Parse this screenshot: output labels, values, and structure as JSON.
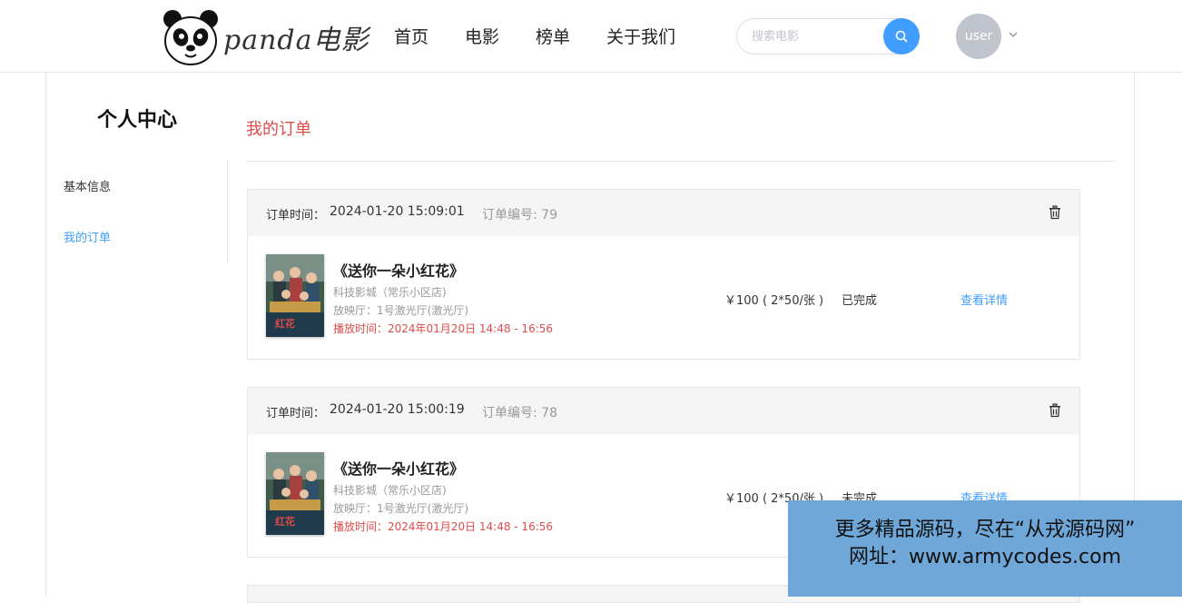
{
  "header": {
    "logo_text": "panda电影",
    "nav": [
      "首页",
      "电影",
      "榜单",
      "关于我们"
    ],
    "search_placeholder": "搜索电影",
    "user_label": "user"
  },
  "sidebar": {
    "title": "个人中心",
    "items": [
      {
        "label": "基本信息",
        "active": false
      },
      {
        "label": "我的订单",
        "active": true
      }
    ]
  },
  "main": {
    "section_title": "我的订单",
    "orders": [
      {
        "time_label": "订单时间：",
        "time": "2024-01-20 15:09:01",
        "order_no": "订单编号: 79",
        "movie_title": "《送你一朵小红花》",
        "cinema": "科技影城（常乐小区店)",
        "hall": "放映厅：1号激光厅(激光厅)",
        "showtime": "播放时间：2024年01月20日 14:48 - 16:56",
        "price": "￥100 ( 2*50/张 )",
        "status": "已完成",
        "detail_label": "查看详情"
      },
      {
        "time_label": "订单时间：",
        "time": "2024-01-20 15:00:19",
        "order_no": "订单编号: 78",
        "movie_title": "《送你一朵小红花》",
        "cinema": "科技影城（常乐小区店)",
        "hall": "放映厅：1号激光厅(激光厅)",
        "showtime": "播放时间：2024年01月20日 14:48 - 16:56",
        "price": "￥100 ( 2*50/张 )",
        "status": "未完成",
        "detail_label": "查看详情"
      }
    ]
  },
  "watermark": {
    "line1": "更多精品源码，尽在“从戎源码网”",
    "line2": "网址：www.armycodes.com"
  },
  "colors": {
    "accent": "#409eff",
    "highlight_red": "#e04b4b",
    "watermark_bg": "#6ea7d8"
  }
}
